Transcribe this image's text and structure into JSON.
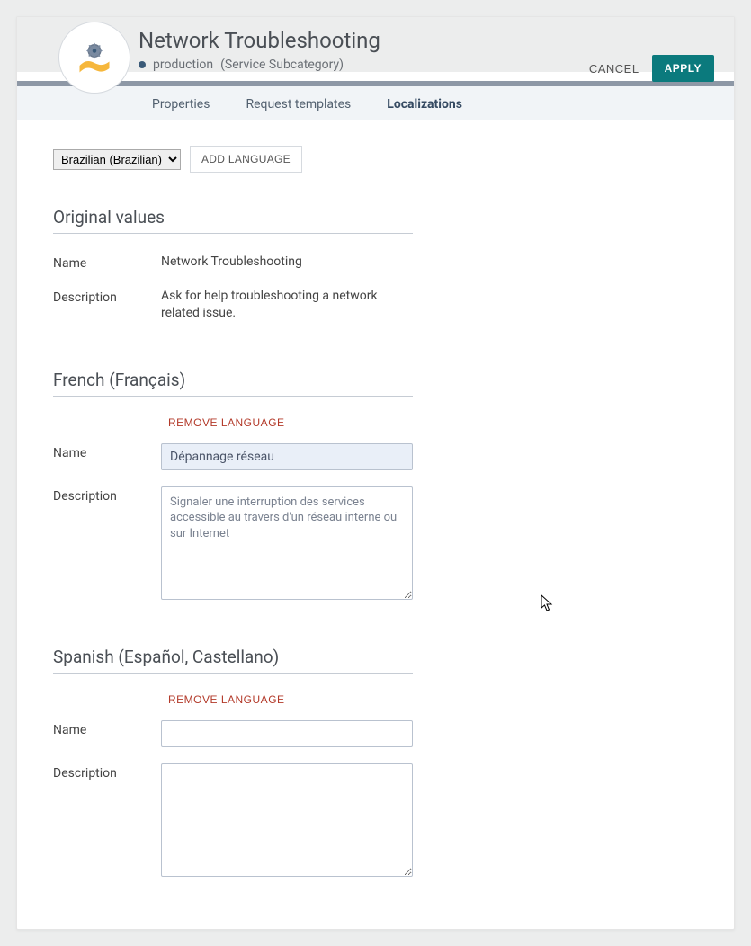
{
  "header": {
    "title": "Network Troubleshooting",
    "env_label": "production",
    "type_label": "(Service Subcategory)",
    "cancel_label": "CANCEL",
    "apply_label": "APPLY"
  },
  "tabs": {
    "properties": "Properties",
    "request_templates": "Request templates",
    "localizations": "Localizations"
  },
  "lang_picker": {
    "selected": "Brazilian (Brazilian)",
    "add_button": "ADD LANGUAGE"
  },
  "original": {
    "section_title": "Original values",
    "name_label": "Name",
    "name_value": "Network Troubleshooting",
    "desc_label": "Description",
    "desc_value": "Ask for help troubleshooting a network related issue."
  },
  "french": {
    "section_title": "French (Français)",
    "remove_label": "REMOVE LANGUAGE",
    "name_label": "Name",
    "name_value": "Dépannage réseau",
    "desc_label": "Description",
    "desc_value": "Signaler une interruption des services accessible au travers d'un réseau interne ou sur Internet"
  },
  "spanish": {
    "section_title": "Spanish (Español, Castellano)",
    "remove_label": "REMOVE LANGUAGE",
    "name_label": "Name",
    "name_value": "",
    "desc_label": "Description",
    "desc_value": ""
  }
}
